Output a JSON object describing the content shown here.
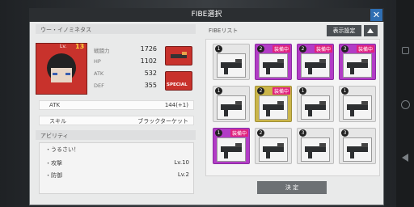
{
  "dialog": {
    "title": "FIBE選択",
    "close_label": "✕"
  },
  "character": {
    "name": "ウー・イノミネタス",
    "level_label": "Lv.",
    "level": "13",
    "stats": [
      {
        "label": "戦闘力",
        "value": "1726"
      },
      {
        "label": "HP",
        "value": "1102"
      },
      {
        "label": "ATK",
        "value": "532"
      },
      {
        "label": "DEF",
        "value": "355"
      }
    ],
    "special_label": "SPECIAL",
    "atk_label": "ATK",
    "atk_value": "144(+1)",
    "skill_label": "スキル",
    "skill_value": "ブラックターケット"
  },
  "ability": {
    "header": "アビリティ",
    "items": [
      {
        "name": "・うるさい！",
        "level": ""
      },
      {
        "name": "・攻撃",
        "level": "Lv.10"
      },
      {
        "name": "・防御",
        "level": "Lv.2"
      }
    ]
  },
  "fibe_list": {
    "header": "FIBEリスト",
    "display_settings": "表示設定",
    "sort_icon": "triangle-up-icon",
    "equipped_label": "装備中",
    "confirm_label": "決 定",
    "slots": [
      {
        "num": "1",
        "equipped": false,
        "gold": false
      },
      {
        "num": "2",
        "equipped": true,
        "gold": false
      },
      {
        "num": "2",
        "equipped": true,
        "gold": false
      },
      {
        "num": "3",
        "equipped": true,
        "gold": false
      },
      {
        "num": "1",
        "equipped": false,
        "gold": false
      },
      {
        "num": "2",
        "equipped": true,
        "gold": true
      },
      {
        "num": "1",
        "equipped": false,
        "gold": false
      },
      {
        "num": "1",
        "equipped": false,
        "gold": false
      },
      {
        "num": "1",
        "equipped": true,
        "gold": false
      },
      {
        "num": "2",
        "equipped": false,
        "gold": false
      },
      {
        "num": "3",
        "equipped": false,
        "gold": false
      },
      {
        "num": "3",
        "equipped": false,
        "gold": false
      }
    ]
  },
  "colors": {
    "accent": "#2f6fb3",
    "equipped": "#b23cc6",
    "tag": "#e0237d"
  }
}
